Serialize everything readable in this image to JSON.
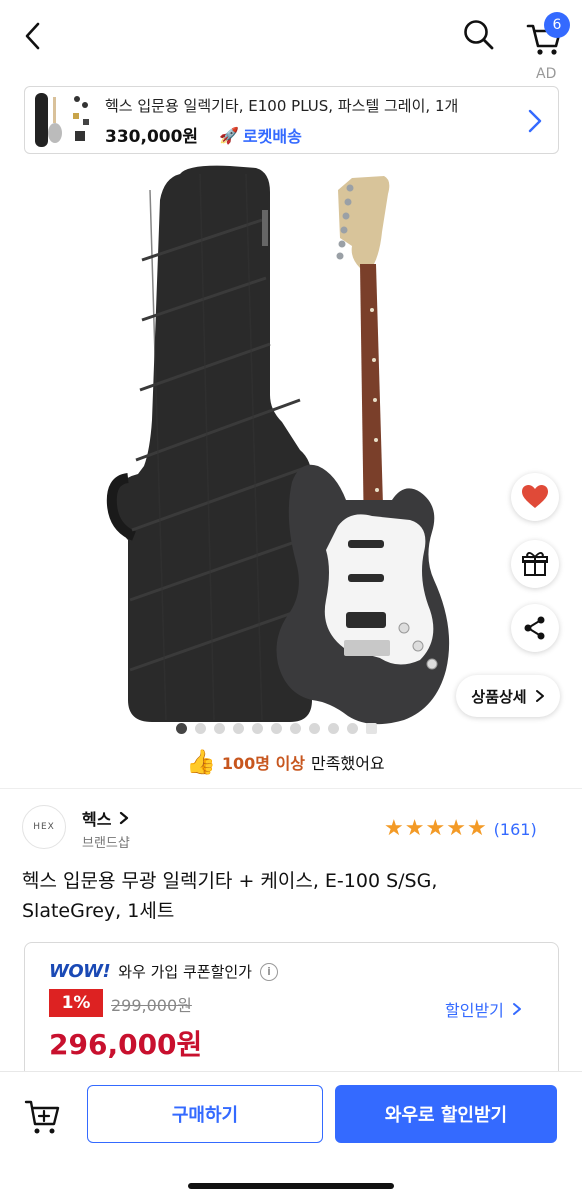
{
  "header": {
    "back_icon": "chevron-left-icon",
    "search_icon": "search-icon",
    "cart_icon": "cart-icon",
    "cart_count": "6",
    "ad_label": "AD"
  },
  "ad_banner": {
    "title": "헥스 입문용 일렉기타, E100 PLUS, 파스텔 그레이, 1개",
    "price": "330,000원",
    "delivery": "로켓배송",
    "rocket_icon": "rocket-icon",
    "chevron_icon": "chevron-right-icon"
  },
  "gallery": {
    "total_images": 11,
    "active_index": 0
  },
  "side_actions": {
    "like_icon": "heart-icon",
    "gift_icon": "gift-icon",
    "share_icon": "share-icon",
    "detail_label": "상품상세"
  },
  "satisfaction": {
    "highlight": "100명 이상",
    "text": "만족했어요",
    "thumb_icon": "thumbs-up-icon"
  },
  "brand": {
    "logo_text": "HEX",
    "name": "헥스",
    "sub": "브랜드샵",
    "rating": 5,
    "review_count": "(161)"
  },
  "product": {
    "title": "헥스 입문용 무광 일렉기타 + 케이스, E-100 S/SG, SlateGrey, 1세트"
  },
  "price": {
    "wow_logo": "WOW!",
    "coupon_label": "와우 가입 쿠폰할인가",
    "discount": "1%",
    "original": "299,000원",
    "final": "296,000원",
    "get_discount_label": "할인받기",
    "colors": {
      "accent": "#346aff",
      "price_red": "#c8102e",
      "badge_red": "#dd2222"
    }
  },
  "bottom_bar": {
    "cart_add_icon": "cart-add-icon",
    "buy_label": "구매하기",
    "wow_label": "와우로 할인받기"
  }
}
